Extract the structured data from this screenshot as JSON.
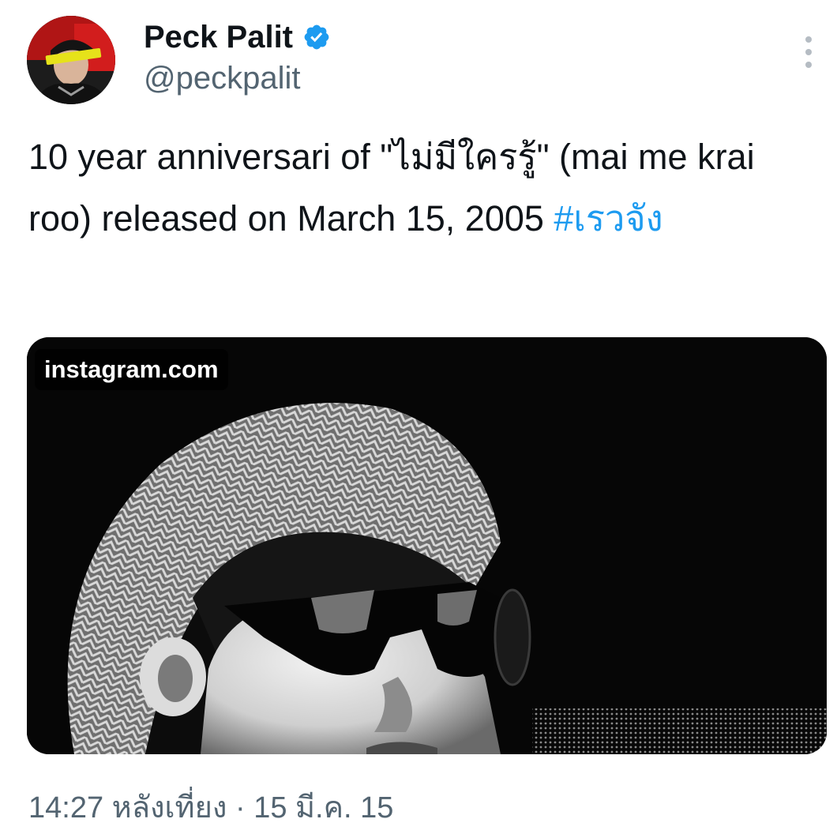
{
  "author": {
    "display_name": "Peck Palit",
    "handle": "@peckpalit",
    "verified": true,
    "avatar_icon": "avatar-photo",
    "verified_icon": "verified-badge-icon"
  },
  "menu": {
    "icon": "more-vertical-icon"
  },
  "tweet": {
    "text_before": "10 year anniversari of \"ไม่มีใครรู้\" (mai me krai roo) released on March 15, 2005 ",
    "hashtag": "#เรวจัง"
  },
  "media": {
    "domain_label": "instagram.com",
    "image_description_icon": "photo-icon"
  },
  "timestamp": {
    "time": "14:27 หลังเที่ยง",
    "separator": "·",
    "date": "15 มี.ค. 15"
  },
  "colors": {
    "link": "#1d9bf0",
    "secondary_text": "#536471",
    "primary_text": "#0f1419",
    "verified": "#1d9bf0"
  }
}
